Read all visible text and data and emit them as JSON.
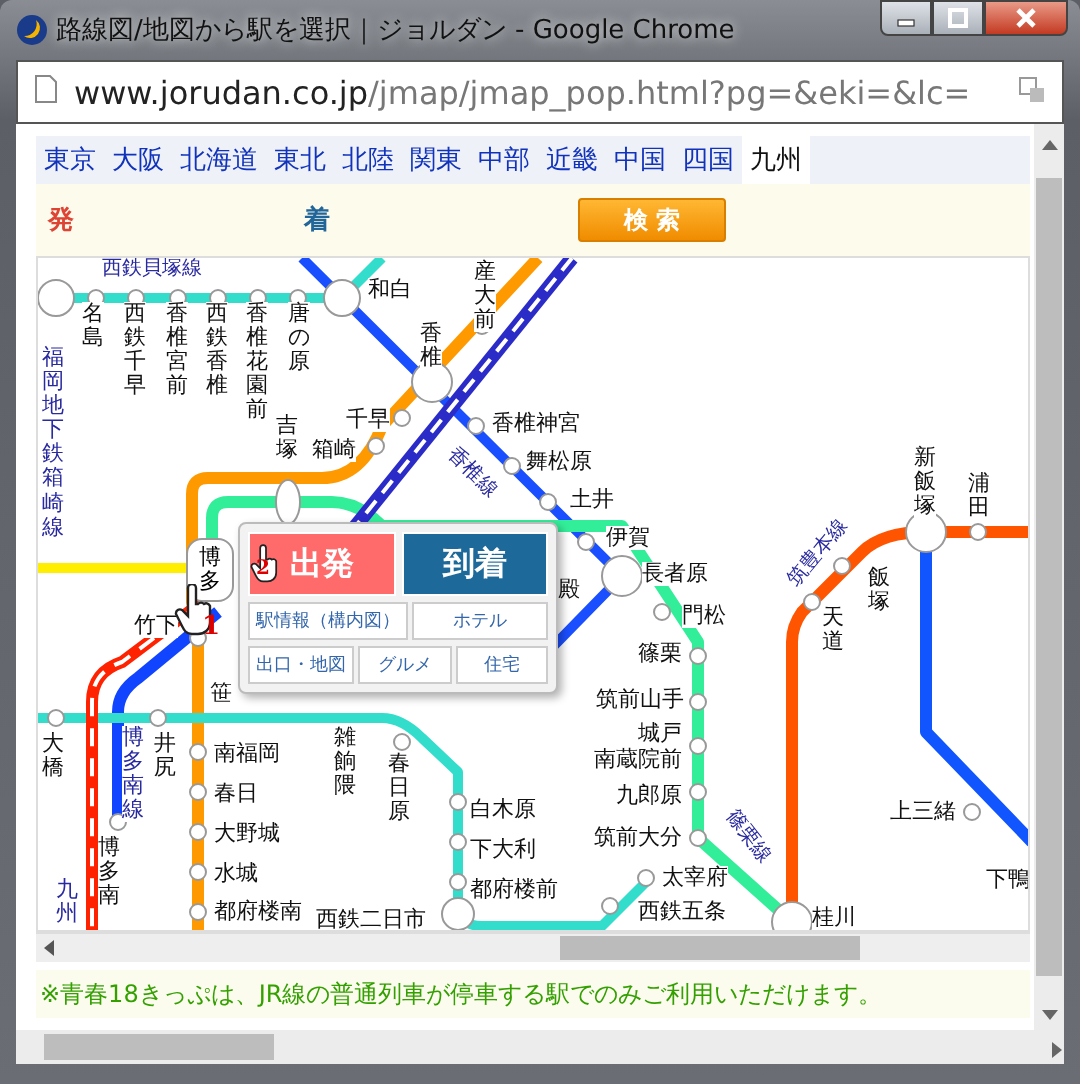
{
  "window": {
    "title": "路線図/地図から駅を選択｜ジョルダン - Google Chrome"
  },
  "address_bar": {
    "host": "www.jorudan.co.jp",
    "path": "/jmap/jmap_pop.html?pg=&eki=&lc="
  },
  "region_tabs": [
    {
      "label": "東京",
      "selected": false
    },
    {
      "label": "大阪",
      "selected": false
    },
    {
      "label": "北海道",
      "selected": false
    },
    {
      "label": "東北",
      "selected": false
    },
    {
      "label": "北陸",
      "selected": false
    },
    {
      "label": "関東",
      "selected": false
    },
    {
      "label": "中部",
      "selected": false
    },
    {
      "label": "近畿",
      "selected": false
    },
    {
      "label": "中国",
      "selected": false
    },
    {
      "label": "四国",
      "selected": false
    },
    {
      "label": "九州",
      "selected": true
    }
  ],
  "route_bar": {
    "from_label": "発",
    "to_label": "着",
    "search_button": "検 索"
  },
  "map": {
    "line_labels": [
      "西鉄貝塚線",
      "福岡地下鉄箱崎線",
      "香椎線",
      "筑豊本線",
      "篠栗線",
      "博多南線",
      "九州"
    ],
    "stations": [
      "名島",
      "西鉄千早",
      "香椎宮前",
      "西鉄香椎",
      "香椎花園前",
      "唐の原",
      "和白",
      "産大前",
      "香椎",
      "吉塚",
      "千早",
      "箱崎",
      "香椎神宮",
      "舞松原",
      "土井",
      "伊賀",
      "長者原",
      "竹下",
      "門松",
      "新飯塚",
      "浦田",
      "飯塚",
      "天道",
      "笹",
      "大橋",
      "井尻",
      "博多南",
      "南福岡",
      "春日",
      "大野城",
      "水城",
      "都府楼南",
      "雑餉隈",
      "春日原",
      "白木原",
      "下大利",
      "都府楼前",
      "西鉄二日市",
      "篠栗",
      "筑前山手",
      "城戸",
      "南蔵院前",
      "九郎原",
      "筑前大分",
      "太宰府",
      "西鉄五条",
      "桂川",
      "上三緒",
      "下鴨",
      "殿"
    ],
    "selected_station": "博多",
    "cursor_marks": [
      "1",
      "2"
    ]
  },
  "station_popup": {
    "buttons": [
      {
        "label": "出発",
        "kind": "depart"
      },
      {
        "label": "到着",
        "kind": "arrive"
      }
    ],
    "links": [
      [
        "駅情報（構内図）",
        "ホテル"
      ],
      [
        "出口・地図",
        "グルメ",
        "住宅"
      ]
    ]
  },
  "note": "※青春18きっぷは、JR線の普通列車が停車する駅でのみご利用いただけます。"
}
